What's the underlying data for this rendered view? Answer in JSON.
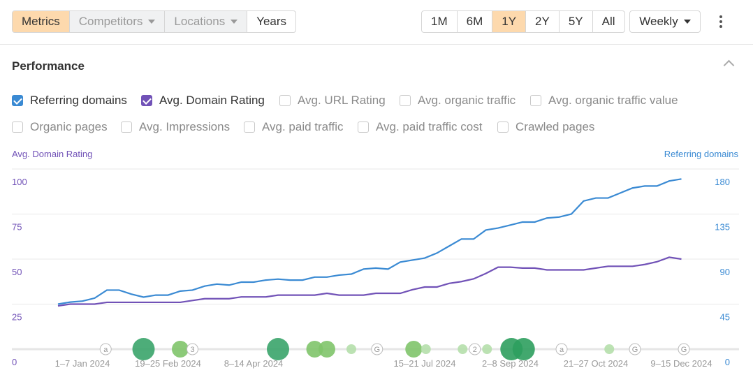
{
  "toolbar": {
    "tabs": [
      "Metrics",
      "Competitors",
      "Locations",
      "Years"
    ],
    "ranges": [
      "1M",
      "6M",
      "1Y",
      "2Y",
      "5Y",
      "All"
    ],
    "active_range": "1Y",
    "interval": "Weekly"
  },
  "section": {
    "title": "Performance"
  },
  "metrics": [
    {
      "label": "Referring domains",
      "checked": true,
      "color": "#3a8ad3"
    },
    {
      "label": "Avg. Domain Rating",
      "checked": true,
      "color": "#7152b7"
    },
    {
      "label": "Avg. URL Rating",
      "checked": false
    },
    {
      "label": "Avg. organic traffic",
      "checked": false
    },
    {
      "label": "Avg. organic traffic value",
      "checked": false
    },
    {
      "label": "Organic pages",
      "checked": false
    },
    {
      "label": "Avg. Impressions",
      "checked": false
    },
    {
      "label": "Avg. paid traffic",
      "checked": false
    },
    {
      "label": "Avg. paid traffic cost",
      "checked": false
    },
    {
      "label": "Crawled pages",
      "checked": false
    }
  ],
  "chart_data": {
    "type": "line",
    "ylabel_left": "Avg. Domain Rating",
    "ylabel_right": "Referring domains",
    "ylim_left": [
      0,
      100
    ],
    "yticks_left": [
      "0",
      "25",
      "50",
      "75",
      "100"
    ],
    "ylim_right": [
      0,
      180
    ],
    "yticks_right": [
      "0",
      "45",
      "90",
      "135",
      "180"
    ],
    "xtick_labels": [
      {
        "label": "1–7 Jan 2024",
        "week": 2
      },
      {
        "label": "19–25 Feb 2024",
        "week": 9
      },
      {
        "label": "8–14 Apr 2024",
        "week": 16
      },
      {
        "label": "15–21 Jul 2024",
        "week": 30
      },
      {
        "label": "2–8 Sep 2024",
        "week": 37
      },
      {
        "label": "21–27 Oct 2024",
        "week": 44
      },
      {
        "label": "9–15 Dec 2024",
        "week": 51
      }
    ],
    "grid": true,
    "series": [
      {
        "name": "Referring domains",
        "axis": "right",
        "color": "#3a8ad3",
        "values": [
          45,
          47,
          48,
          51,
          59,
          59,
          55,
          52,
          54,
          54,
          58,
          59,
          63,
          65,
          64,
          67,
          67,
          69,
          70,
          69,
          69,
          72,
          72,
          74,
          75,
          80,
          81,
          80,
          87,
          89,
          91,
          96,
          103,
          110,
          110,
          119,
          121,
          124,
          127,
          127,
          131,
          132,
          135,
          148,
          151,
          151,
          156,
          161,
          163,
          163,
          168,
          170
        ]
      },
      {
        "name": "Avg. Domain Rating",
        "axis": "left",
        "color": "#7152b7",
        "values": [
          24,
          25,
          25,
          25,
          26,
          26,
          26,
          26,
          26,
          26,
          26,
          27,
          28,
          28,
          28,
          29,
          29,
          29,
          30,
          30,
          30,
          30,
          31,
          30,
          30,
          30,
          31,
          31,
          31,
          33,
          34.5,
          34.5,
          36.5,
          37.5,
          39,
          42,
          45.5,
          45.5,
          45,
          45,
          44,
          44,
          44,
          44,
          45,
          46,
          46,
          46,
          47,
          48.5,
          51,
          50
        ]
      }
    ],
    "annotations": [
      {
        "week": 3.9,
        "kind": "letter",
        "text": "a"
      },
      {
        "week": 7,
        "kind": "bubble",
        "size": "large",
        "color": "#3aa46a"
      },
      {
        "week": 10,
        "kind": "bubble",
        "size": "medium",
        "color": "#7fc46a"
      },
      {
        "week": 11,
        "kind": "letter",
        "text": "3"
      },
      {
        "week": 18,
        "kind": "bubble",
        "size": "large",
        "color": "#3aa46a"
      },
      {
        "week": 21,
        "kind": "bubble",
        "size": "medium",
        "color": "#7fc46a"
      },
      {
        "week": 22,
        "kind": "bubble",
        "size": "medium",
        "color": "#7fc46a"
      },
      {
        "week": 24,
        "kind": "bubble",
        "size": "small",
        "color": "#b5dfab"
      },
      {
        "week": 26.1,
        "kind": "letter",
        "text": "G"
      },
      {
        "week": 29.1,
        "kind": "bubble",
        "size": "medium",
        "color": "#7fc46a"
      },
      {
        "week": 30.1,
        "kind": "bubble",
        "size": "small",
        "color": "#b5dfab"
      },
      {
        "week": 33.1,
        "kind": "bubble",
        "size": "small",
        "color": "#b5dfab"
      },
      {
        "week": 34.1,
        "kind": "letter",
        "text": "2"
      },
      {
        "week": 35.1,
        "kind": "bubble",
        "size": "small",
        "color": "#b5dfab"
      },
      {
        "week": 37.1,
        "kind": "bubble",
        "size": "large",
        "color": "#2e9e5e"
      },
      {
        "week": 38.1,
        "kind": "bubble",
        "size": "large",
        "color": "#2e9e5e"
      },
      {
        "week": 41.2,
        "kind": "letter",
        "text": "a"
      },
      {
        "week": 45.1,
        "kind": "bubble",
        "size": "small",
        "color": "#b5dfab"
      },
      {
        "week": 47.2,
        "kind": "letter",
        "text": "G"
      },
      {
        "week": 51.2,
        "kind": "letter",
        "text": "G"
      }
    ]
  }
}
